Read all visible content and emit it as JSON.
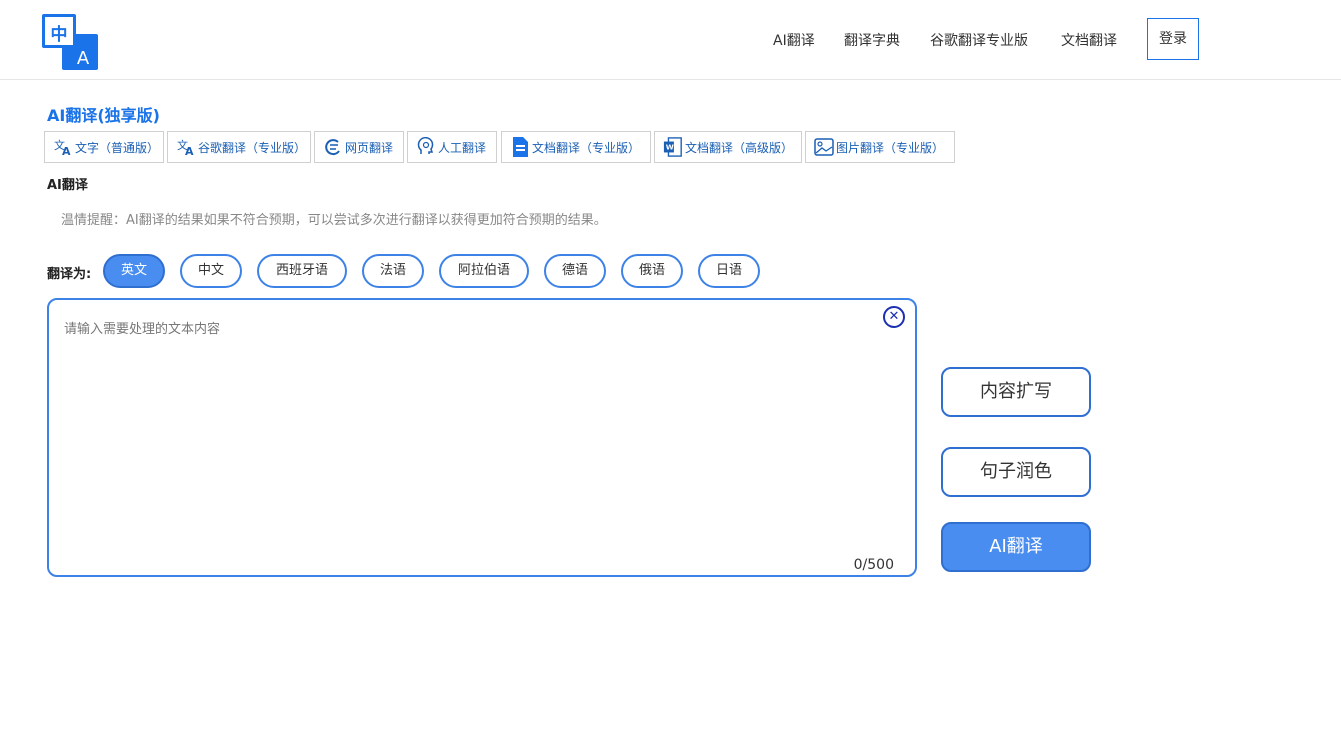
{
  "header": {
    "logo": {
      "cn_glyph": "中",
      "en_glyph": "A"
    },
    "nav": [
      "AI翻译",
      "翻译字典",
      "谷歌翻译专业版",
      "文档翻译"
    ],
    "login_label": "登录"
  },
  "section_title": "AI翻译(独享版)",
  "tool_tabs": [
    {
      "label": "文字（普通版）",
      "icon": "translate-icon"
    },
    {
      "label": "谷歌翻译（专业版）",
      "icon": "translate-icon"
    },
    {
      "label": "网页翻译",
      "icon": "web-page-icon"
    },
    {
      "label": "人工翻译",
      "icon": "human-brain-icon"
    },
    {
      "label": "文档翻译（专业版）",
      "icon": "document-icon"
    },
    {
      "label": "文档翻译（高级版）",
      "icon": "word-document-icon"
    },
    {
      "label": "图片翻译（专业版）",
      "icon": "image-icon"
    }
  ],
  "sub_title": "AI翻译",
  "tip": "温情提醒：AI翻译的结果如果不符合预期，可以尝试多次进行翻译以获得更加符合预期的结果。",
  "target_language": {
    "label": "翻译为:",
    "selected": "英文",
    "options": [
      "英文",
      "中文",
      "西班牙语",
      "法语",
      "阿拉伯语",
      "德语",
      "俄语",
      "日语"
    ]
  },
  "input": {
    "placeholder": "请输入需要处理的文本内容",
    "value": "",
    "counter": "0/500",
    "clear_symbol": "✕"
  },
  "actions": {
    "expand_label": "内容扩写",
    "polish_label": "句子润色",
    "translate_label": "AI翻译"
  },
  "colors": {
    "accent": "#1a73e8",
    "button_primary": "#4a8df0",
    "border_blue": "#3d82e6"
  }
}
